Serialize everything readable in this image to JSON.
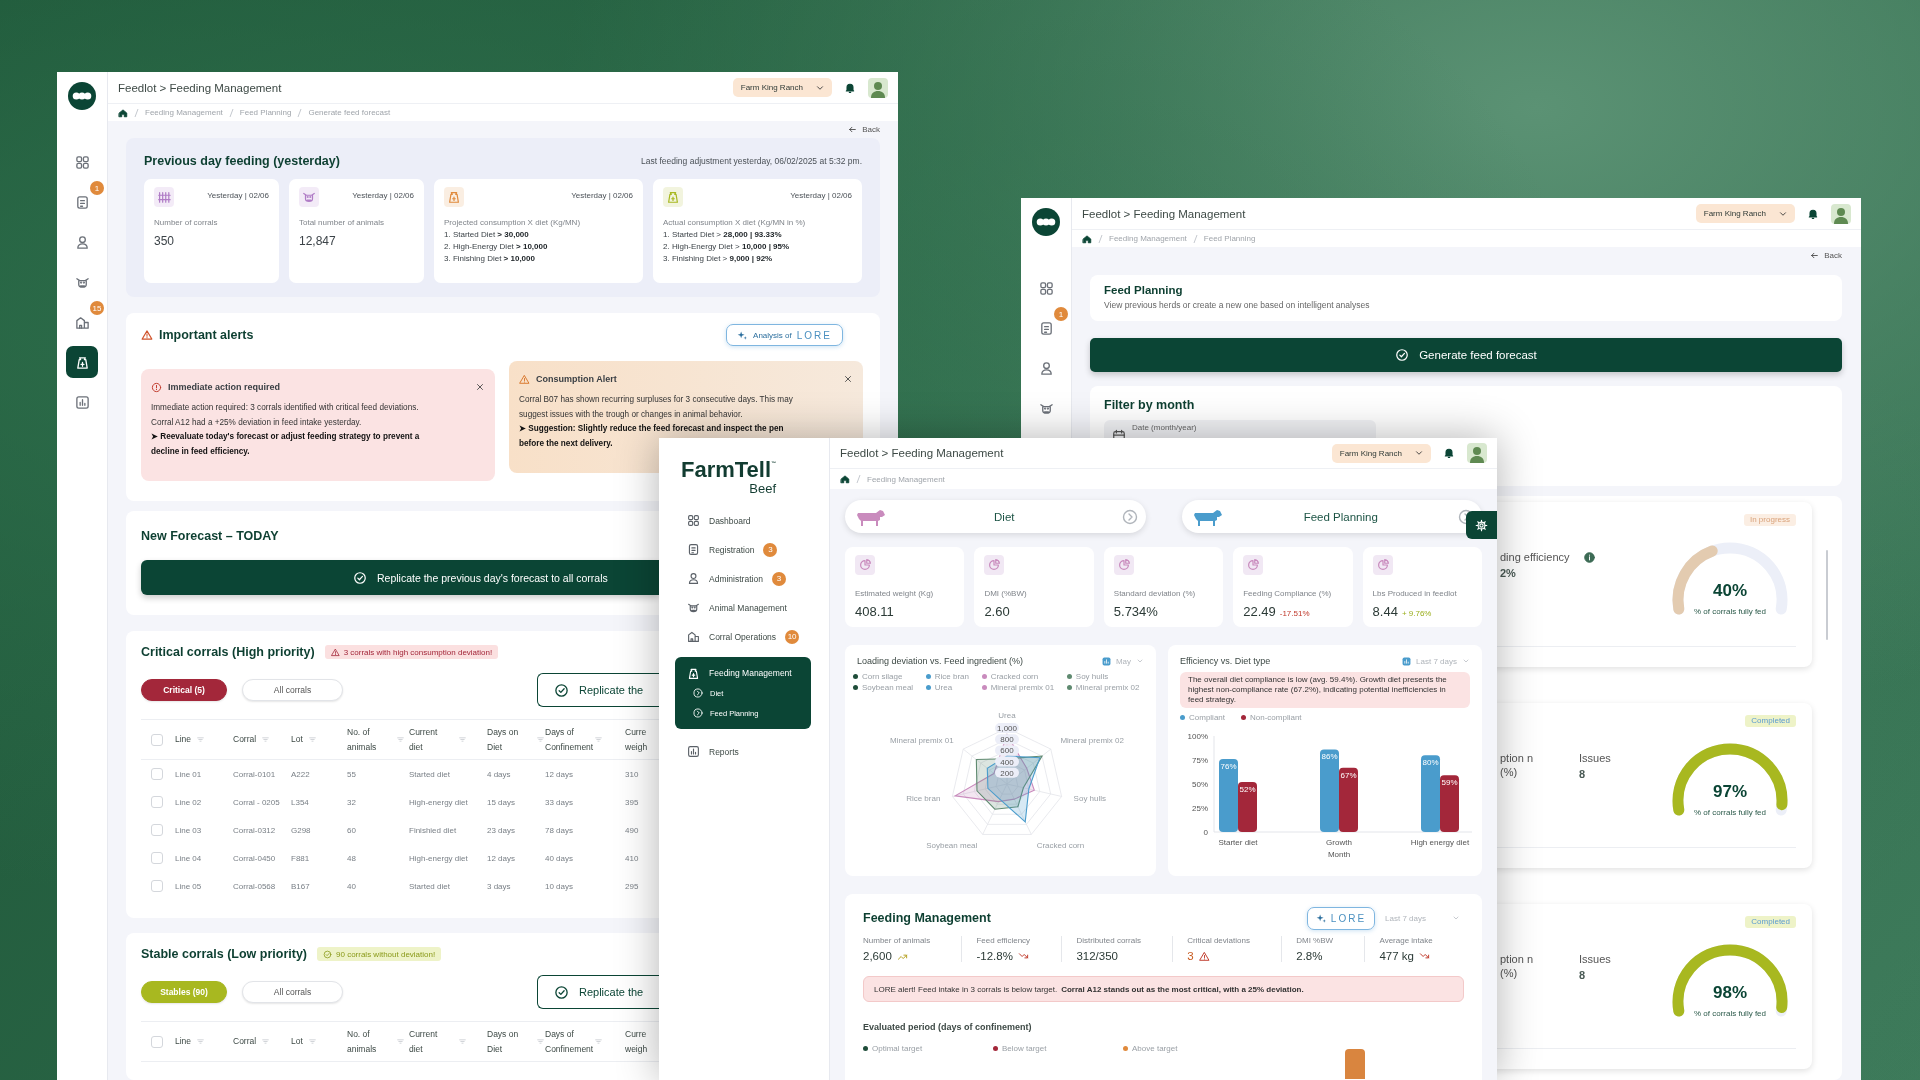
{
  "forecast_window": {
    "title": "Feedlot > Feeding Management",
    "ranch": "Farm King Ranch",
    "sidebar": [
      {
        "selected": false
      },
      {
        "selected": false,
        "badge": "1"
      },
      {
        "selected": false
      },
      {
        "selected": false
      },
      {
        "selected": false,
        "badge": "15"
      },
      {
        "selected": true
      },
      {
        "selected": false
      }
    ],
    "breadcrumbs": [
      "Feeding Management",
      "Feed Planning",
      "Generate feed forecast"
    ],
    "back": "Back",
    "previous_day": {
      "title": "Previous day feeding (yesterday)",
      "note": "Last feeding adjustment yesterday, 06/02/2025 at 5:32 pm.",
      "cards": [
        {
          "kind": "stat",
          "date": "Yesterday | 02/06",
          "label": "Number of corrals",
          "value": "350",
          "color": "#b07cc6"
        },
        {
          "kind": "stat",
          "date": "Yesterday | 02/06",
          "label": "Total number of animals",
          "value": "12,847",
          "color": "#b07cc6"
        },
        {
          "kind": "list",
          "date": "Yesterday | 02/06",
          "label": "Projected consumption X diet (Kg/MN)",
          "lines": [
            "1. Started Diet **> 30,000**",
            "2. High-Energy Diet **> 10,000**",
            "3. Finishing Diet **> 10,000**"
          ],
          "color": "#e08a3c"
        },
        {
          "kind": "list",
          "date": "Yesterday | 02/06",
          "label": "Actual consumption X diet (Kg/MN in %)",
          "lines": [
            "1. Started Diet > **28,000 | 93.33%**",
            "2. High-Energy Diet > **10,000 | 95%**",
            "3. Finishing Diet > **9,000 | 92%**"
          ],
          "color": "#a8b820"
        }
      ]
    },
    "alerts": {
      "title": "Important alerts",
      "analysis_button": "Analysis of",
      "lore": "LORE",
      "items": [
        {
          "kind": "danger",
          "title": "Immediate action required",
          "lines": [
            {
              "text": "Immediate action required: 3 corrals identified with critical feed deviations.",
              "bold": false
            },
            {
              "text": "Corral A12 had a +25% deviation in feed intake yesterday.",
              "bold": false
            },
            {
              "text": "➤ Reevaluate today's forecast or adjust feeding strategy to prevent a",
              "bold": true
            },
            {
              "text": "decline in feed efficiency.",
              "bold": true
            }
          ]
        },
        {
          "kind": "warning",
          "title": "Consumption Alert",
          "lines": [
            {
              "text": "Corral B07 has shown recurring surpluses for 3 consecutive days. This may",
              "bold": false
            },
            {
              "text": "suggest issues with the trough or changes in animal behavior.",
              "bold": false
            },
            {
              "text": "➤ Suggestion: Slightly reduce the feed forecast and inspect the pen",
              "bold": true
            },
            {
              "text": "before the next delivery.",
              "bold": true
            }
          ]
        }
      ]
    },
    "new_forecast": {
      "title": "New Forecast – TODAY",
      "button": "Replicate the previous day's forecast to all corrals"
    },
    "corral_groups": [
      {
        "kind": "critical",
        "title": "Critical corrals (High priority)",
        "tag": "3 corrals with high consumption deviation!",
        "filters": [
          {
            "label": "Critical (5)",
            "selected": true
          },
          {
            "label": "All corrals",
            "selected": false
          }
        ],
        "replicate": "Replicate the",
        "select_all_checked": false,
        "columns": [
          "Line",
          "Corral",
          "Lot",
          "No. of animals",
          "Current diet",
          "Days on Diet",
          "Days of Confinement",
          "Curre weigh"
        ],
        "rows": [
          {
            "checked": false,
            "cells": [
              "Line 01",
              "Corral-0101",
              "A222",
              "55",
              "Started diet",
              "4 days",
              "12 days",
              "310"
            ]
          },
          {
            "checked": false,
            "cells": [
              "Line 02",
              "Corral - 0205",
              "L354",
              "32",
              "High-energy diet",
              "15 days",
              "33 days",
              "395"
            ]
          },
          {
            "checked": false,
            "cells": [
              "Line 03",
              "Corral-0312",
              "G298",
              "60",
              "Finishied diet",
              "23 days",
              "78 days",
              "490"
            ]
          },
          {
            "checked": false,
            "cells": [
              "Line 04",
              "Corral-0450",
              "F881",
              "48",
              "High-energy diet",
              "12 days",
              "40 days",
              "410"
            ]
          },
          {
            "checked": false,
            "cells": [
              "Line 05",
              "Corral-0568",
              "B167",
              "40",
              "Started diet",
              "3 days",
              "10 days",
              "295"
            ]
          }
        ]
      },
      {
        "kind": "stable",
        "title": "Stable corrals (Low priority)",
        "tag": "90 corrals without deviation!",
        "filters": [
          {
            "label": "Stables (90)",
            "selected": true
          },
          {
            "label": "All corrals",
            "selected": false
          }
        ],
        "replicate": "Replicate the",
        "select_all_checked": false,
        "columns": [
          "Line",
          "Corral",
          "Lot",
          "No. of animals",
          "Current diet",
          "Days on Diet",
          "Days of Confinement",
          "Curre weigh"
        ]
      }
    ]
  },
  "planning_window": {
    "title": "Feedlot > Feeding Management",
    "ranch": "Farm King Ranch",
    "sidebar": [
      {
        "selected": false
      },
      {
        "selected": false,
        "badge": "1"
      },
      {
        "selected": false
      },
      {
        "selected": false
      }
    ],
    "breadcrumbs": [
      "Feeding Management",
      "Feed Planning"
    ],
    "back": "Back",
    "intro": {
      "title": "Feed Planning",
      "text": "View previous herds or create a new one based on intelligent analyses"
    },
    "button": "Generate feed forecast",
    "filter": {
      "title": "Filter by month",
      "field_label": "Date (month/year)"
    },
    "plans": [
      {
        "status": "In progress",
        "kind": "progress",
        "metric": "ding efficiency",
        "metric_value": "2%",
        "value": "40%",
        "caption": "% of corrals fully fed"
      },
      {
        "status": "Completed",
        "kind": "done",
        "metric": "ption n (%)",
        "issues_label": "Issues",
        "issues": "8",
        "value": "97%",
        "caption": "% of corrals fully fed"
      },
      {
        "status": "Completed",
        "kind": "done",
        "metric": "ption n (%)",
        "issues_label": "Issues",
        "issues": "8",
        "value": "98%",
        "caption": "% of corrals fully fed"
      }
    ]
  },
  "overview_window": {
    "logo": {
      "name": "FarmTell",
      "mark": "™",
      "sub": "Beef"
    },
    "nav": [
      {
        "label": "Dashboard",
        "selected": false
      },
      {
        "label": "Registration",
        "badge": "3",
        "selected": false
      },
      {
        "label": "Administration",
        "badge": "3",
        "selected": false
      },
      {
        "label": "Animal Management",
        "selected": false
      },
      {
        "label": "Corral Operations",
        "badge": "10",
        "selected": false
      },
      {
        "label": "Feeding Management",
        "selected": true,
        "children": [
          {
            "label": "Diet",
            "selected": false
          },
          {
            "label": "Feed Planning",
            "selected": false
          }
        ]
      },
      {
        "label": "Reports",
        "selected": false
      }
    ],
    "title": "Feedlot > Feeding Management",
    "ranch": "Farm King Ranch",
    "breadcrumbs": [
      "Feeding Management"
    ],
    "shortcuts": [
      {
        "label": "Diet",
        "color": "#c98bbd"
      },
      {
        "label": "Feed Planning",
        "color": "#4a9ccc"
      }
    ],
    "metrics": [
      {
        "kind": "plain",
        "label": "Estimated weight (Kg)",
        "value": "408.11"
      },
      {
        "kind": "plain",
        "label": "DMI (%BW)",
        "value": "2.60"
      },
      {
        "kind": "plain",
        "label": "Standard deviation (%)",
        "value": "5.734%"
      },
      {
        "kind": "down",
        "label": "Feeding Compliance (%)",
        "value": "22.49",
        "change": "-17.51%"
      },
      {
        "kind": "up",
        "label": "Lbs Produced in feedlot",
        "value": "8.44",
        "change": "+ 9.76%"
      }
    ],
    "radar": {
      "title": "Loading deviation vs. Feed ingredient (%)",
      "period": "May",
      "legend": [
        {
          "label": "Corn silage",
          "color": "#1f4d3a"
        },
        {
          "label": "Rice bran",
          "color": "#4a9ccc"
        },
        {
          "label": "Cracked corn",
          "color": "#c98bbd"
        },
        {
          "label": "Soy hulls",
          "color": "#5f8a70"
        },
        {
          "label": "Soybean meal",
          "color": "#1f4d3a"
        },
        {
          "label": "Urea",
          "color": "#4a9ccc"
        },
        {
          "label": "Mineral premix 01",
          "color": "#c98bbd"
        },
        {
          "label": "Mineral premix 02",
          "color": "#5f8a70"
        }
      ],
      "axes": [
        "Urea",
        "Mineral premix 02",
        "Soy hulls",
        "Cracked corn",
        "Soybean meal",
        "Rice bran",
        "Mineral premix 01"
      ],
      "ticks": [
        "1,000",
        "800",
        "600",
        "400",
        "200"
      ]
    },
    "efficiency": {
      "title": "Efficiency vs. Diet type",
      "period": "Last 7 days",
      "alert": "The overall diet compliance is low (avg. 59.4%). Growth diet presents the highest non-compliance rate (67.2%), indicating potential inefficiencies in feed strategy.",
      "chart_data": {
        "type": "bar",
        "xlabel": "Month",
        "categories": [
          "Starter diet",
          "Growth",
          "High energy diet"
        ],
        "series": [
          {
            "name": "Compliant",
            "color": "#4a9ccc",
            "values": [
              76,
              86,
              80
            ]
          },
          {
            "name": "Non-compliant",
            "color": "#a3273a",
            "values": [
              52,
              67,
              59
            ]
          }
        ],
        "yticks": [
          0,
          {
            "value": 25,
            "label": "25%"
          },
          {
            "value": 50,
            "label": "50%"
          },
          {
            "value": 75,
            "label": "75%"
          },
          {
            "value": 100,
            "label": "100%"
          }
        ],
        "ylim": [
          0,
          100
        ],
        "stacked": false,
        "value_labels": [
          [
            "76%",
            "86%",
            "80%"
          ],
          [
            "52%",
            "67%",
            "59%"
          ]
        ]
      }
    },
    "feeding": {
      "title": "Feeding Management",
      "lore": "LORE",
      "period": "Last 7 days",
      "kpis": [
        {
          "kind": "up",
          "label": "Number of animals",
          "value": "2,600"
        },
        {
          "kind": "down",
          "label": "Feed efficiency",
          "value": "-12.8%"
        },
        {
          "kind": "plain",
          "label": "Distributed corrals",
          "value": "312/350"
        },
        {
          "kind": "alert",
          "label": "Critical deviations",
          "value": "3"
        },
        {
          "kind": "plain",
          "label": "DMI %BW",
          "value": "2.8%"
        },
        {
          "kind": "down",
          "label": "Average intake",
          "value": "477 kg"
        }
      ],
      "alert": "LORE alert! Feed intake in 3 corrals is below target. **Corral A12 stands out as the most critical, with a 25% deviation.**",
      "period_title": "Evaluated period (days of confinement)",
      "legend": [
        {
          "label": "Optimal target",
          "color": "#1f4d3a"
        },
        {
          "label": "Below target",
          "color": "#a3273a"
        },
        {
          "label": "Above target",
          "color": "#e08a3c"
        }
      ]
    }
  }
}
